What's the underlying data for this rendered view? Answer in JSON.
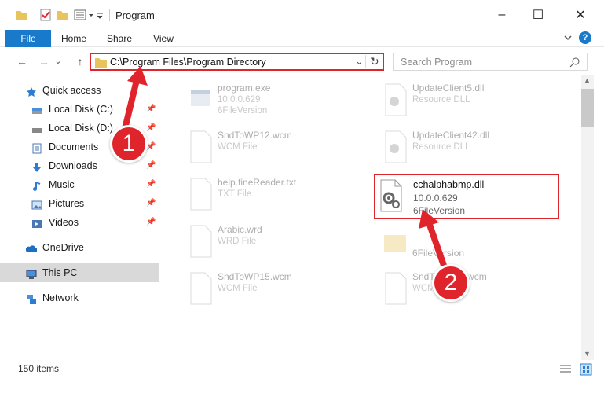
{
  "window": {
    "title": "Program",
    "minimize_icon": "–",
    "maximize_icon": "☐",
    "close_icon": "✕"
  },
  "ribbon": {
    "tabs": [
      "File",
      "Home",
      "Share",
      "View"
    ],
    "active_tab": "File",
    "accent": "#1979ca"
  },
  "nav": {
    "back": "←",
    "forward": "→",
    "recent": "⌄",
    "up": "↑"
  },
  "address": {
    "path": "C:\\Program Files\\Program Directory",
    "dropdown": "⌄",
    "refresh": "↻"
  },
  "search": {
    "placeholder": "Search Program"
  },
  "sidebar": {
    "quick_access": "Quick access",
    "items": [
      {
        "label": "Local Disk (C:)",
        "icon": "drive-icon"
      },
      {
        "label": "Local Disk (D:)",
        "icon": "drive-icon"
      },
      {
        "label": "Documents",
        "icon": "documents-icon"
      },
      {
        "label": "Downloads",
        "icon": "downloads-icon"
      },
      {
        "label": "Music",
        "icon": "music-icon"
      },
      {
        "label": "Pictures",
        "icon": "pictures-icon"
      },
      {
        "label": "Videos",
        "icon": "videos-icon"
      }
    ],
    "onedrive": "OneDrive",
    "this_pc": "This PC",
    "network": "Network"
  },
  "files": {
    "left": [
      {
        "name": "program.exe",
        "line2": "10.0.0.629",
        "line3": "6FileVersion"
      },
      {
        "name": "SndToWP12.wcm",
        "line2": "WCM File"
      },
      {
        "name": "help.fineReader.txt",
        "line2": "TXT File"
      },
      {
        "name": "Arabic.wrd",
        "line2": "WRD File"
      },
      {
        "name": "SndToWP15.wcm",
        "line2": "WCM File"
      }
    ],
    "right": [
      {
        "name": "UpdateClient5.dll",
        "line2": "Resource DLL"
      },
      {
        "name": "UpdateClient42.dll",
        "line2": "Resource DLL"
      },
      {
        "name": "cchalphabmp.dll",
        "line2": "10.0.0.629",
        "line3": "6FileVersion"
      },
      {
        "name": "6FileVersion",
        "line2": ""
      },
      {
        "name": "SndToWP13.wcm",
        "line2": "WCM File"
      }
    ]
  },
  "status": {
    "count": "150 items"
  },
  "annotations": {
    "badge1": "1",
    "badge2": "2",
    "color": "#e0242b"
  }
}
